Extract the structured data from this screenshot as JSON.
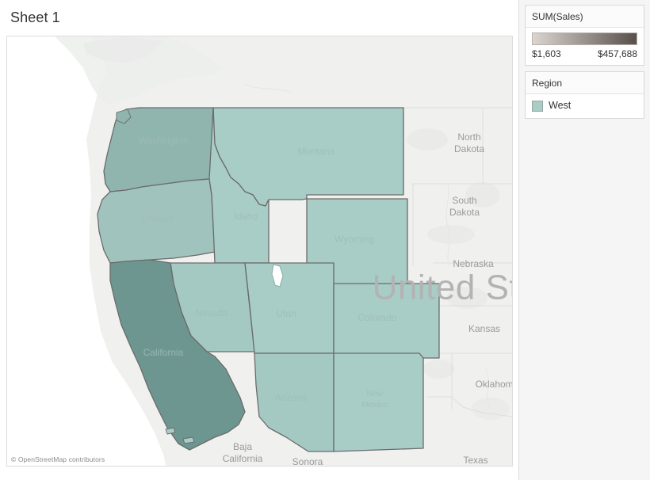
{
  "worksheet": {
    "title": "Sheet 1",
    "attribution": "© OpenStreetMap contributors"
  },
  "legend": {
    "color_legend": {
      "title": "SUM(Sales)",
      "min_label": "$1,603",
      "max_label": "$457,688",
      "gradient_start": "#dcd5cf",
      "gradient_end": "#584f4a"
    },
    "region_legend": {
      "title": "Region",
      "items": [
        {
          "label": "West",
          "color": "#a8ccc6"
        }
      ]
    }
  },
  "map": {
    "background_color": "#f0f0ee",
    "water_color": "#ffffff",
    "border_color": "#6b6b6b",
    "country_label": "United States",
    "highlighted_states": [
      {
        "name": "Washington",
        "color": "#8fb5ae"
      },
      {
        "name": "Oregon",
        "color": "#a0c4bd"
      },
      {
        "name": "Idaho",
        "color": "#a8ccc6"
      },
      {
        "name": "Montana",
        "color": "#a8ccc6"
      },
      {
        "name": "Wyoming",
        "color": "#a8ccc6"
      },
      {
        "name": "California",
        "color": "#6d9690"
      },
      {
        "name": "Nevada",
        "color": "#a4c9c3"
      },
      {
        "name": "Utah",
        "color": "#a8ccc6"
      },
      {
        "name": "Colorado",
        "color": "#a8ccc6"
      },
      {
        "name": "Arizona",
        "color": "#a4c9c3"
      },
      {
        "name": "New Mexico",
        "color": "#a8ccc6"
      }
    ],
    "other_labels": [
      "North Dakota",
      "South Dakota",
      "Nebraska",
      "Kansas",
      "Oklahoma",
      "Texas",
      "Baja California",
      "Sonora"
    ]
  }
}
